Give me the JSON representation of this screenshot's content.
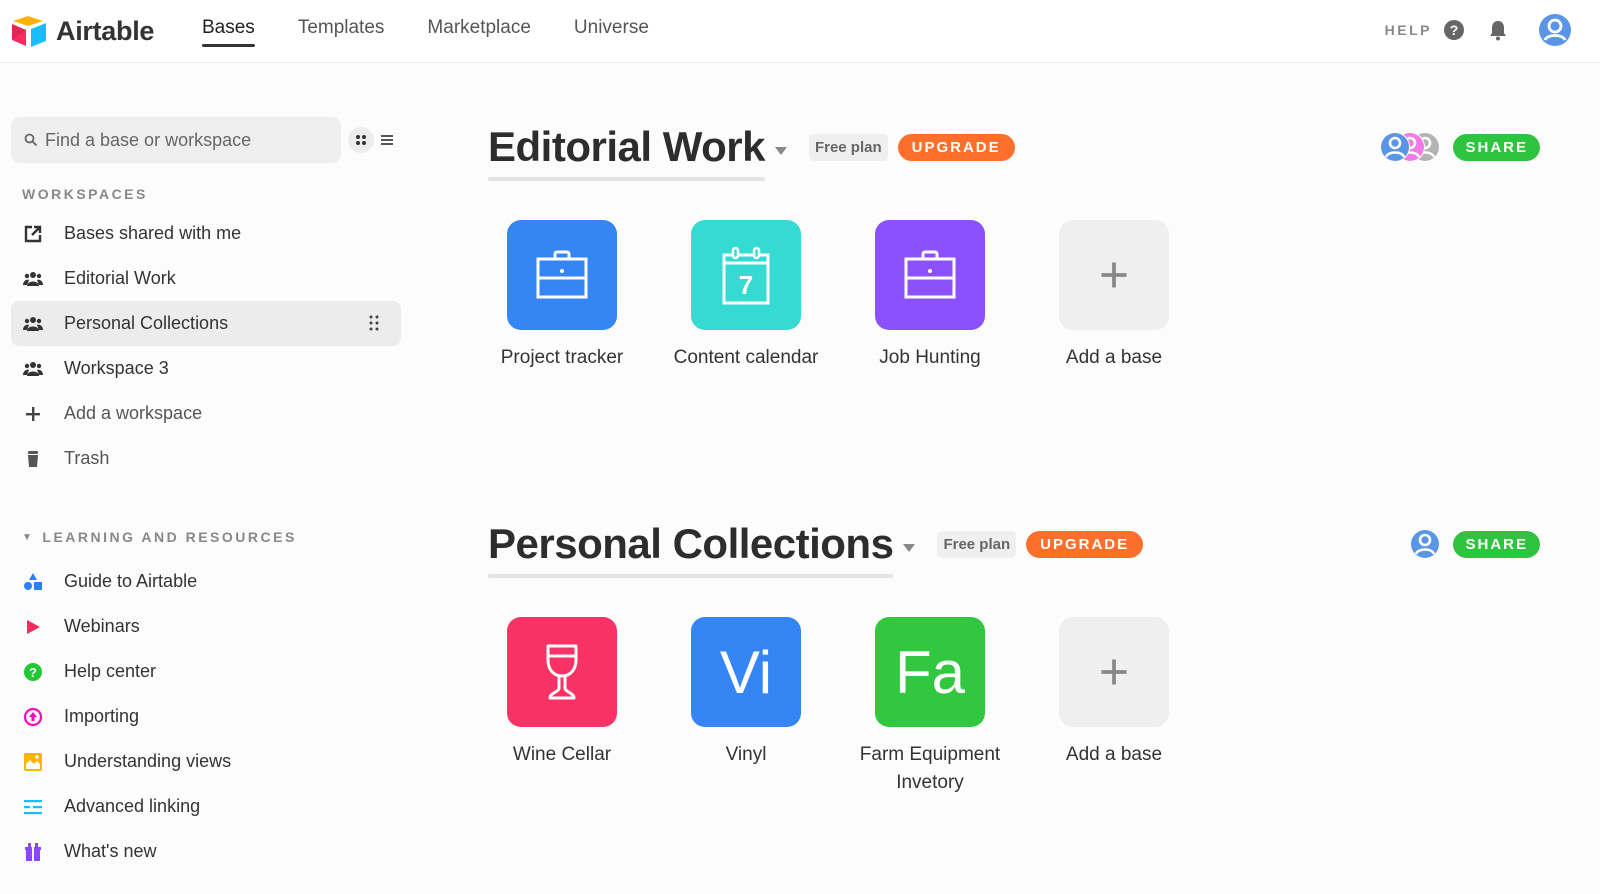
{
  "app": {
    "name": "Airtable",
    "nav": [
      {
        "label": "Bases",
        "active": true
      },
      {
        "label": "Templates",
        "active": false
      },
      {
        "label": "Marketplace",
        "active": false
      },
      {
        "label": "Universe",
        "active": false
      }
    ],
    "help_label": "HELP",
    "icons": {
      "help": "question-circle-icon",
      "notifications": "bell-icon",
      "account": "user-avatar-icon"
    }
  },
  "sidebar": {
    "search": {
      "placeholder": "Find a base or workspace",
      "value": ""
    },
    "workspaces_label": "WORKSPACES",
    "workspaces": [
      {
        "label": "Bases shared with me",
        "icon": "shared-link-icon",
        "active": false
      },
      {
        "label": "Editorial Work",
        "icon": "group-icon",
        "active": false
      },
      {
        "label": "Personal Collections",
        "icon": "group-icon",
        "active": true
      },
      {
        "label": "Workspace 3",
        "icon": "group-icon",
        "active": false
      },
      {
        "label": "Add a workspace",
        "icon": "plus-icon",
        "active": false
      },
      {
        "label": "Trash",
        "icon": "trash-icon",
        "active": false
      }
    ],
    "resources_label": "LEARNING AND RESOURCES",
    "resources": [
      {
        "label": "Guide to Airtable",
        "icon": "shapes-icon",
        "color": "#2d7ff9"
      },
      {
        "label": "Webinars",
        "icon": "play-icon",
        "color": "#f82b60"
      },
      {
        "label": "Help center",
        "icon": "question-circle-icon",
        "color": "#20c933"
      },
      {
        "label": "Importing",
        "icon": "upload-circle-icon",
        "color": "#ff08c2"
      },
      {
        "label": "Understanding views",
        "icon": "image-icon",
        "color": "#fcb400"
      },
      {
        "label": "Advanced linking",
        "icon": "sliders-icon",
        "color": "#18bfff"
      },
      {
        "label": "What's new",
        "icon": "gift-icon",
        "color": "#8b46ff"
      }
    ]
  },
  "workspaces": [
    {
      "title": "Editorial Work",
      "plan": "Free plan",
      "upgrade_label": "UPGRADE",
      "share_label": "SHARE",
      "collaborators": [
        "#5b95e8",
        "#f07ae6",
        "#b3b3b3"
      ],
      "bases": [
        {
          "name": "Project tracker",
          "icon": "briefcase-icon",
          "color": "#3685f5"
        },
        {
          "name": "Content calendar",
          "icon": "calendar-icon",
          "color": "#35dbd3",
          "icon_text": "7"
        },
        {
          "name": "Job Hunting",
          "icon": "briefcase-icon",
          "color": "#8c51ff"
        },
        {
          "name": "Add a base",
          "icon": "plus-icon",
          "color": "#efefef",
          "add": true
        }
      ]
    },
    {
      "title": "Personal Collections",
      "plan": "Free plan",
      "upgrade_label": "UPGRADE",
      "share_label": "SHARE",
      "collaborators": [
        "#5b95e8"
      ],
      "bases": [
        {
          "name": "Wine Cellar",
          "icon": "wine-glass-icon",
          "color": "#f83264"
        },
        {
          "name": "Vinyl",
          "icon": "text-initials",
          "color": "#3685f5",
          "icon_text": "Vi"
        },
        {
          "name": "Farm Equipment Invetory",
          "icon": "text-initials",
          "color": "#31c840",
          "icon_text": "Fa"
        },
        {
          "name": "Add a base",
          "icon": "plus-icon",
          "color": "#efefef",
          "add": true
        }
      ]
    }
  ]
}
